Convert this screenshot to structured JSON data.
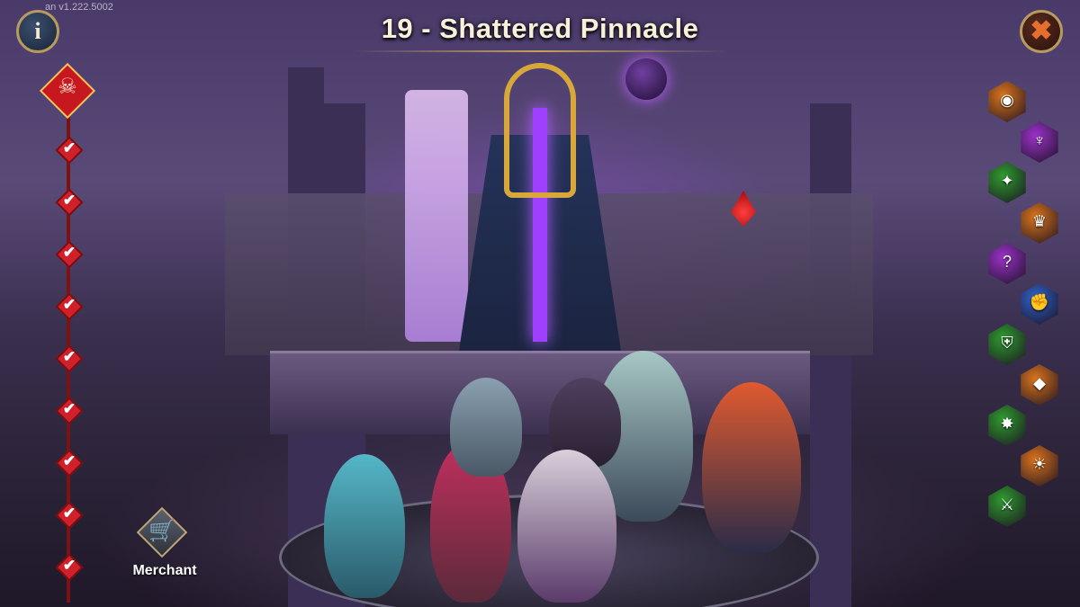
{
  "version": "an v1.222.5002",
  "title": "19 - Shattered Pinnacle",
  "buttons": {
    "info_glyph": "i",
    "close_glyph": "✖"
  },
  "progress": {
    "boss_icon": "demon-skull-icon",
    "completed_nodes": 9,
    "check_glyph": "✔"
  },
  "merchant": {
    "label": "Merchant",
    "icon": "cart-icon",
    "glyph": "🛒"
  },
  "artifacts": [
    {
      "name": "ring-artifact",
      "color": "#d9741c",
      "glyph": "◉"
    },
    {
      "name": "trident-artifact",
      "color": "#9a32c8",
      "glyph": "♆"
    },
    {
      "name": "crest-artifact",
      "color": "#2f9b2f",
      "glyph": "✦"
    },
    {
      "name": "crown-artifact",
      "color": "#d9741c",
      "glyph": "♛"
    },
    {
      "name": "question-artifact",
      "color": "#9a32c8",
      "glyph": "?"
    },
    {
      "name": "fist-artifact",
      "color": "#2f62c8",
      "glyph": "✊"
    },
    {
      "name": "shield-artifact",
      "color": "#2f9b2f",
      "glyph": "⛨"
    },
    {
      "name": "gem-artifact",
      "color": "#d9741c",
      "glyph": "◆"
    },
    {
      "name": "spike-artifact",
      "color": "#2f9b2f",
      "glyph": "✸"
    },
    {
      "name": "sun-artifact",
      "color": "#d9741c",
      "glyph": "☀"
    },
    {
      "name": "wolf-artifact",
      "color": "#2f9b2f",
      "glyph": "⚔"
    }
  ]
}
